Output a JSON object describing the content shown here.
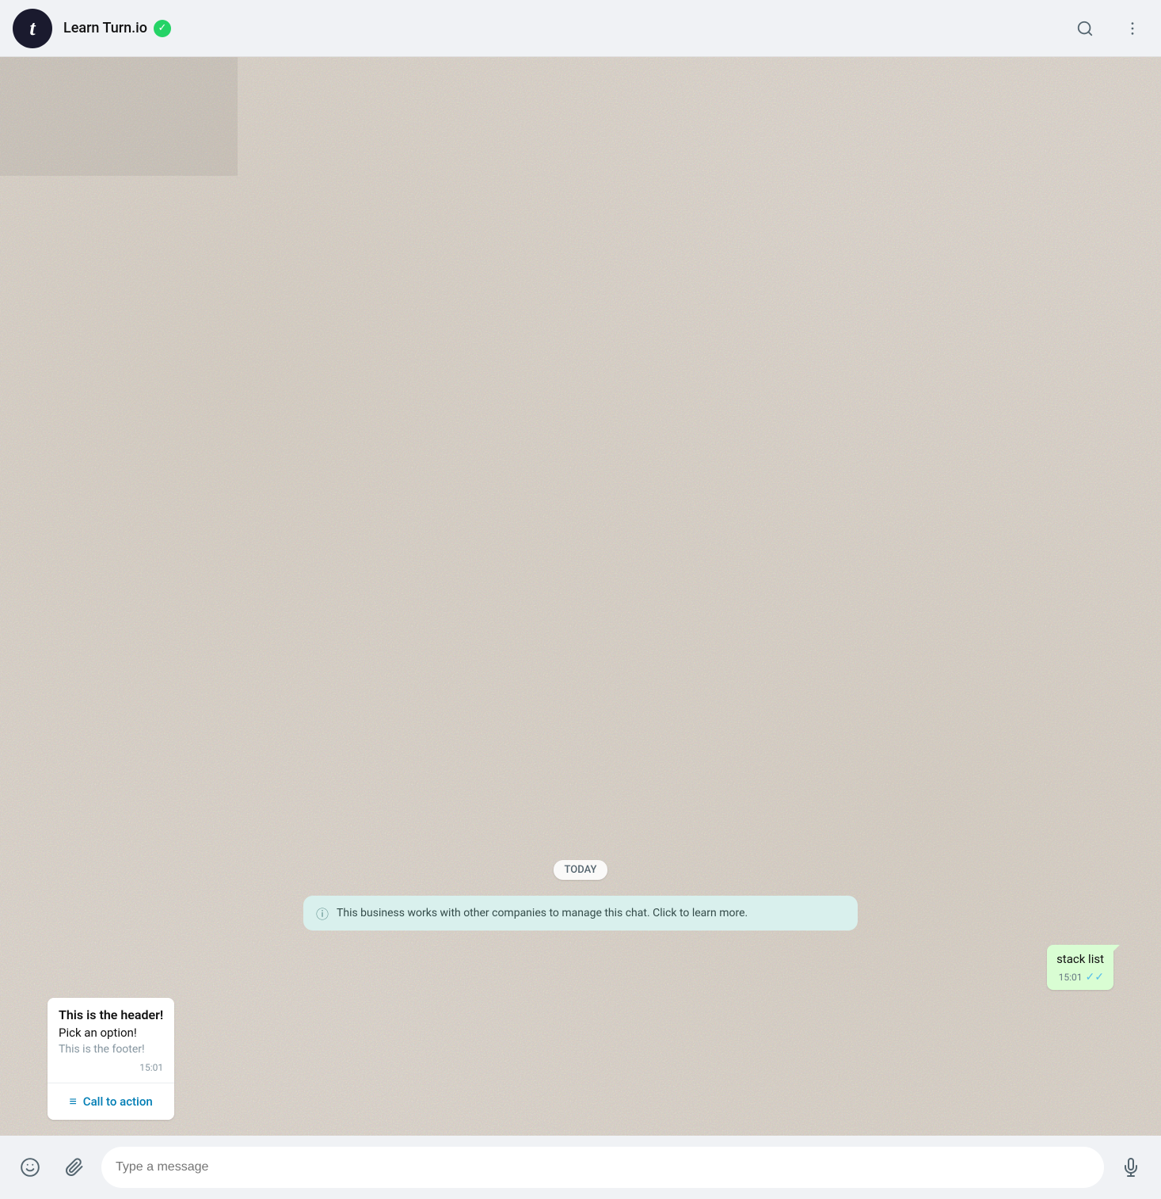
{
  "header": {
    "avatar_letter": "t",
    "contact_name": "Learn Turn.io",
    "verified": true,
    "search_label": "search",
    "menu_label": "menu"
  },
  "chat": {
    "date_separator": "TODAY",
    "info_banner": "This business works with other companies to manage this chat. Click to learn more.",
    "outgoing_message": {
      "text": "stack list",
      "time": "15:01",
      "read": true
    },
    "incoming_card": {
      "header": "This is the header!",
      "body": "Pick an option!",
      "footer": "This is the footer!",
      "time": "15:01",
      "cta_icon": "≡",
      "cta_label": "Call to action"
    }
  },
  "footer": {
    "emoji_label": "emoji",
    "attach_label": "attach",
    "input_placeholder": "Type a message",
    "mic_label": "microphone"
  }
}
